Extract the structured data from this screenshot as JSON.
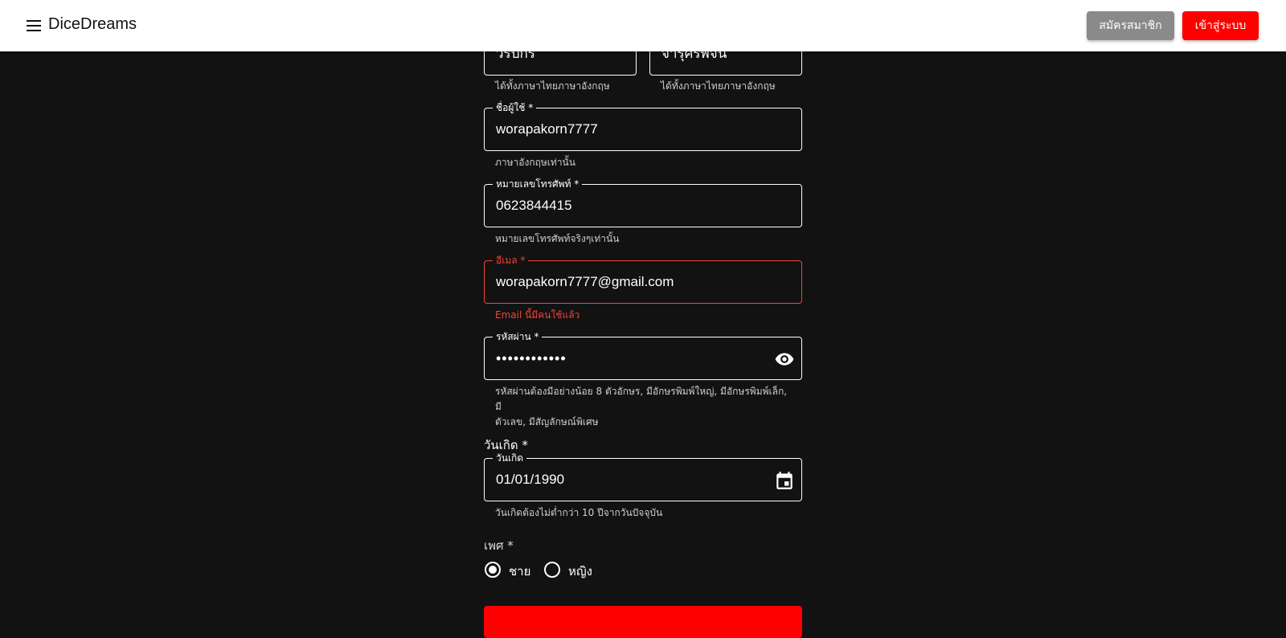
{
  "appbar": {
    "brand": "DiceDreams",
    "register_label": "สมัครสมาชิก",
    "login_label": "เข้าสู่ระบบ"
  },
  "form": {
    "first_name": {
      "value": "วรปกร",
      "helper": "ได้ทั้งภาษาไทยภาษาอังกฤษ"
    },
    "last_name": {
      "value": "จารุศรีพจน์",
      "helper": "ได้ทั้งภาษาไทยภาษาอังกฤษ"
    },
    "username": {
      "label": "ชื่อผู้ใช้ *",
      "value": "worapakorn7777",
      "helper": "ภาษาอังกฤษเท่านั้น"
    },
    "phone": {
      "label": "หมายเลขโทรศัพท์ *",
      "value": "0623844415",
      "helper": "หมายเลขโทรศัพท์จริงๆเท่านั้น"
    },
    "email": {
      "label": "อีเมล *",
      "value": "worapakorn7777@gmail.com",
      "error": "Email นี้มีคนใช้แล้ว"
    },
    "password": {
      "label": "รหัสผ่าน *",
      "value": "••••••••••••",
      "helper_line1": "รหัสผ่านต้องมีอย่างน้อย 8 ตัวอักษร, มีอักษรพิมพ์ใหญ่, มีอักษรพิมพ์เล็ก, มี",
      "helper_line2": "ตัวเลข, มีสัญลักษณ์พิเศษ"
    },
    "birthday": {
      "section_label": "วันเกิด *",
      "label": "วันเกิด",
      "value": "01/01/1990",
      "helper": "วันเกิดต้องไม่ต่ำกว่า 10 ปีจากวันปัจจุบัน"
    },
    "gender": {
      "section_label": "เพศ *",
      "options": [
        {
          "label": "ชาย",
          "selected": true
        },
        {
          "label": "หญิง",
          "selected": false
        }
      ]
    }
  },
  "icons": {
    "menu": "menu-icon",
    "visibility": "eye-icon",
    "calendar": "calendar-icon"
  },
  "colors": {
    "accent": "#ff0000",
    "error": "#f44336",
    "background": "#121212",
    "register_button": "#8a8a8a"
  }
}
